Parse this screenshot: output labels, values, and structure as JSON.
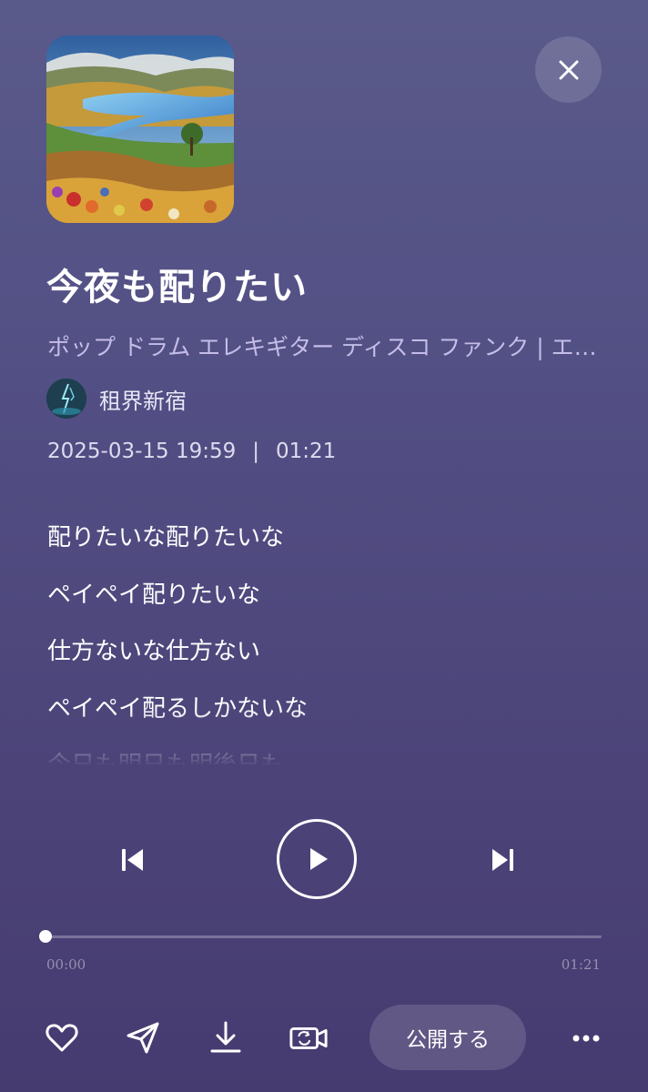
{
  "song": {
    "title": "今夜も配りたい",
    "tags": "ポップ ドラム エレキギター ディスコ ファンク | エ…",
    "artist": "租界新宿",
    "date": "2025-03-15 19:59",
    "separator": "|",
    "duration": "01:21"
  },
  "lyrics": [
    "配りたいな配りたいな",
    "ペイペイ配りたいな",
    "仕方ないな仕方ない",
    "ペイペイ配るしかないな",
    "今日も明日も明後日も"
  ],
  "player": {
    "current_time": "00:00",
    "total_time": "01:21",
    "progress_fraction": 0
  },
  "actions": {
    "publish_label": "公開する"
  },
  "icons": {
    "close": "close-icon",
    "previous": "skip-previous-icon",
    "play": "play-icon",
    "next": "skip-next-icon",
    "like": "heart-icon",
    "share": "paper-plane-icon",
    "download": "download-icon",
    "video": "video-camera-icon",
    "more": "more-dots-icon"
  },
  "colors": {
    "background_top": "#5a5a8a",
    "background_bottom": "#463b70",
    "tags_text": "#c5bde8",
    "foreground": "#ffffff"
  }
}
